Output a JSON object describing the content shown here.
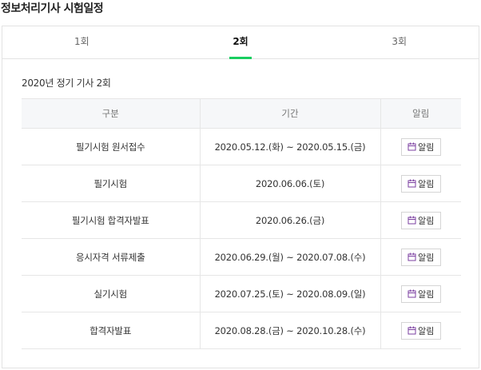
{
  "page": {
    "title": "정보처리기사 시험일정"
  },
  "tabs": [
    {
      "label": "1회",
      "active": false
    },
    {
      "label": "2회",
      "active": true
    },
    {
      "label": "3회",
      "active": false
    }
  ],
  "section": {
    "title": "2020년 정기 기사 2회"
  },
  "table": {
    "headers": [
      "구분",
      "기간",
      "알림"
    ],
    "rows": [
      {
        "category": "필기시험 원서접수",
        "period": "2020.05.12.(화) ~ 2020.05.15.(금)",
        "alarm": "알림"
      },
      {
        "category": "필기시험",
        "period": "2020.06.06.(토)",
        "alarm": "알림"
      },
      {
        "category": "필기시험 합격자발표",
        "period": "2020.06.26.(금)",
        "alarm": "알림"
      },
      {
        "category": "응시자격 서류제출",
        "period": "2020.06.29.(월) ~ 2020.07.08.(수)",
        "alarm": "알림"
      },
      {
        "category": "실기시험",
        "period": "2020.07.25.(토) ~ 2020.08.09.(일)",
        "alarm": "알림"
      },
      {
        "category": "합격자발표",
        "period": "2020.08.28.(금) ~ 2020.10.28.(수)",
        "alarm": "알림"
      }
    ]
  },
  "icons": {
    "alarm": "calendar-icon"
  },
  "colors": {
    "active_tab_underline": "#19ce60",
    "calendar_icon": "#7b3fa0"
  }
}
